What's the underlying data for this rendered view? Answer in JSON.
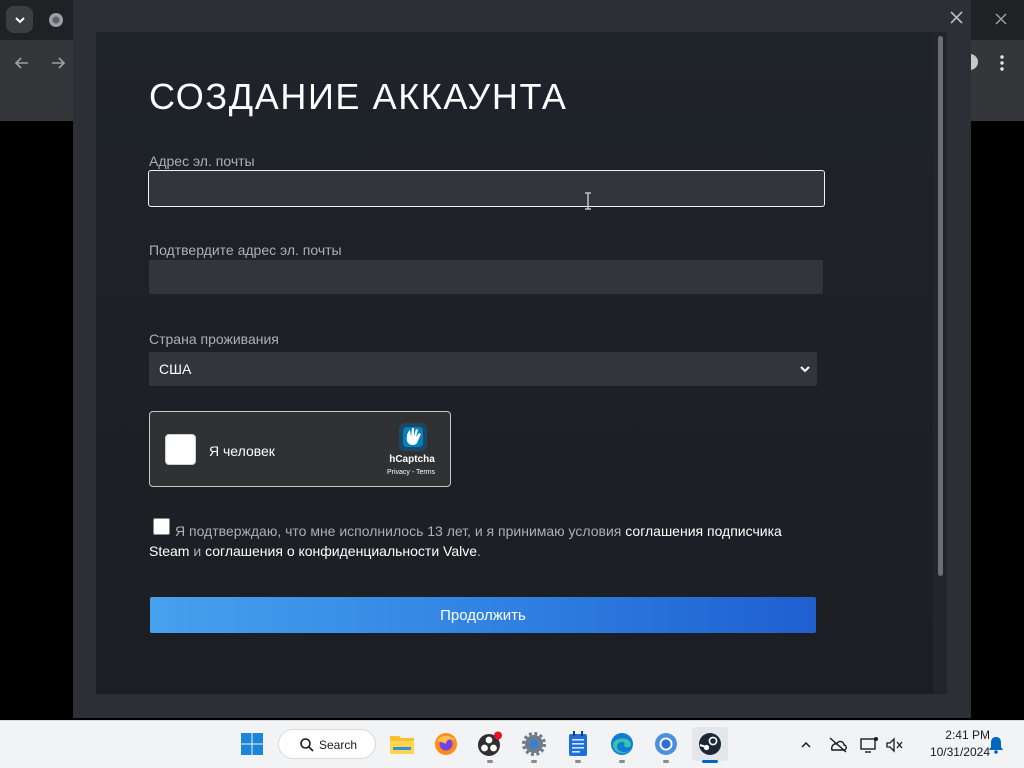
{
  "form": {
    "title": "СОЗДАНИЕ АККАУНТА",
    "email_label": "Адрес эл. почты",
    "email_value": "",
    "confirm_email_label": "Подтвердите адрес эл. почты",
    "confirm_email_value": "",
    "country_label": "Страна проживания",
    "country_selected": "США",
    "captcha": {
      "label": "Я человек",
      "brand": "hCaptcha",
      "links": "Privacy - Terms"
    },
    "agreement": {
      "text_1": "Я подтверждаю, что мне исполнилось 13 лет, и я принимаю условия ",
      "link_1": "соглашения подписчика Steam",
      "text_2": " и ",
      "link_2": "соглашения о конфиденциальности Valve",
      "text_3": "."
    },
    "continue_label": "Продолжить"
  },
  "taskbar": {
    "search_label": "Search",
    "clock_time": "2:41 PM",
    "clock_date": "10/31/2024"
  },
  "colors": {
    "dialog_bg": "#2c2f35",
    "panel_bg": "#1f232a",
    "input_bg": "#32353c",
    "label_color": "#aab1b8",
    "button_gradient_start": "#47a1ee",
    "button_gradient_end": "#1f5fd0",
    "taskbar_bg": "#f1f3f5",
    "accent": "#0067c0"
  },
  "icons": {
    "tab_menu": "chevron-down-icon",
    "window_close": "close-icon",
    "back": "arrow-left-icon",
    "forward": "arrow-right-icon",
    "select": "chevron-down-icon",
    "captcha_logo": "hcaptcha-logo-icon"
  }
}
